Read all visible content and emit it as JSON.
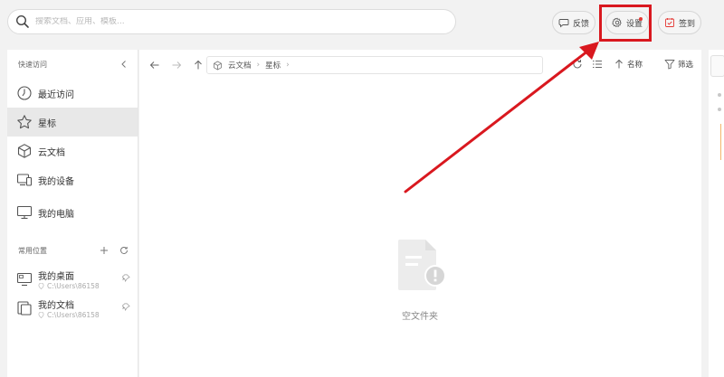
{
  "search": {
    "placeholder": "搜索文档、应用、模板..."
  },
  "topbar": {
    "feedback_label": "反馈",
    "settings_label": "设置",
    "checkin_label": "签到"
  },
  "sidebar": {
    "quick_access_title": "快速访问",
    "items": [
      {
        "label": "最近访问",
        "icon": "clock-icon"
      },
      {
        "label": "星标",
        "icon": "star-icon",
        "active": true
      },
      {
        "label": "云文档",
        "icon": "cube-icon"
      },
      {
        "label": "我的设备",
        "icon": "devices-icon"
      },
      {
        "label": "我的电脑",
        "icon": "monitor-icon"
      }
    ],
    "common_places_title": "常用位置",
    "places": [
      {
        "name": "我的桌面",
        "path": "C:\\Users\\86158"
      },
      {
        "name": "我的文档",
        "path": "C:\\Users\\86158"
      }
    ]
  },
  "toolbar": {
    "breadcrumbs": [
      "云文档",
      "星标"
    ],
    "sort_label": "名称",
    "filter_label": "筛选"
  },
  "main": {
    "empty_label": "空文件夹"
  },
  "colors": {
    "highlight": "#d9181f",
    "accent_red": "#e53935",
    "orange": "#f4b56a"
  }
}
